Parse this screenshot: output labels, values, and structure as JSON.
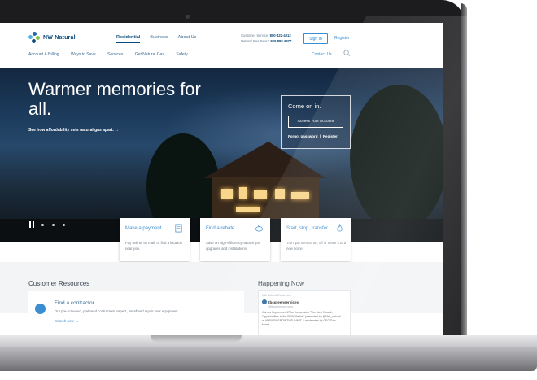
{
  "site": {
    "logo_text": "NW Natural",
    "top_nav": [
      "Residential",
      "Business",
      "About Us"
    ],
    "contact_line1_label": "Customer Service:",
    "contact_line1_value": "800-422-4012",
    "contact_line2_label": "Natural Gas Odor?",
    "contact_line2_value": "800-882-3377",
    "sign_in": "Sign In",
    "register": "Register",
    "sub_nav": [
      "Account & Billing",
      "Ways to Save",
      "Services",
      "Get Natural Gas",
      "Safety"
    ],
    "contact_us": "Contact Us"
  },
  "hero": {
    "headline_line1": "Warmer memories for",
    "headline_line2": "all.",
    "subline": "See how affordability sets natural gas apart. →",
    "login_title": "Come on in.",
    "access_button": "Access Your Account",
    "forgot": "Forgot password",
    "separator": "|",
    "register": "Register"
  },
  "cards": [
    {
      "title": "Make a payment",
      "body": "Pay online, by mail, or find a location near you.",
      "icon": "bill-icon"
    },
    {
      "title": "Find a rebate",
      "body": "Save on high-efficiency natural gas upgrades and installations.",
      "icon": "piggy-bank-icon"
    },
    {
      "title": "Start, stop, transfer",
      "body": "Turn gas service on, off or move it to a new home.",
      "icon": "flame-icon"
    }
  ],
  "resources": {
    "title": "Customer Resources",
    "contractor_title": "Find a contractor",
    "contractor_body": "Our pre-screened, preferred contractors inspect, install and repair your equipment.",
    "contractor_link": "Search now →"
  },
  "happening": {
    "title": "Happening Now",
    "tweet_meta": "NW Natural Retweeted",
    "tweet_name": "tbsgreenservices",
    "tweet_handle": "@tbsgreenservices",
    "tweet_text": "Join us September 17 for the session \"The Next Growth Opportunities in the PNW Market\" presented by @NW_natural at #DRIVENGROWTHSUMMIT & moderated by CEO Tom Marra."
  },
  "colors": {
    "brand": "#0a4b7a",
    "accent": "#3a8dd0"
  }
}
